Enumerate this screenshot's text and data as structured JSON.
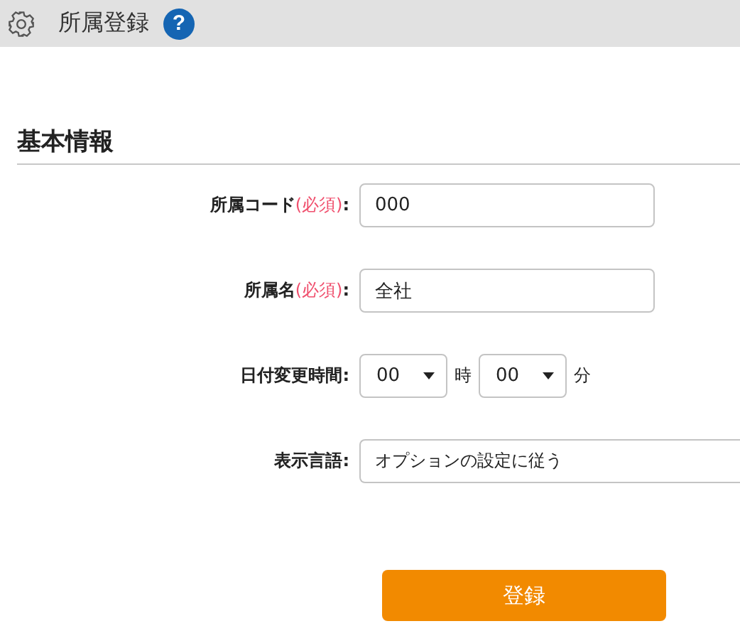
{
  "header": {
    "title": "所属登録",
    "help_icon": "?"
  },
  "section": {
    "title": "基本情報"
  },
  "fields": [
    {
      "kind": "text",
      "label": "所属コード",
      "required_mark": "(必須)",
      "colon": ":",
      "value": "000"
    },
    {
      "kind": "text",
      "label": "所属名",
      "required_mark": "(必須)",
      "colon": ":",
      "value": "全社"
    },
    {
      "kind": "time",
      "label": "日付変更時間",
      "colon": ":",
      "hour": "00",
      "hour_unit": "時",
      "minute": "00",
      "minute_unit": "分"
    },
    {
      "kind": "select",
      "label": "表示言語",
      "colon": ":",
      "value": "オプションの設定に従う"
    }
  ],
  "submit": "登録"
}
